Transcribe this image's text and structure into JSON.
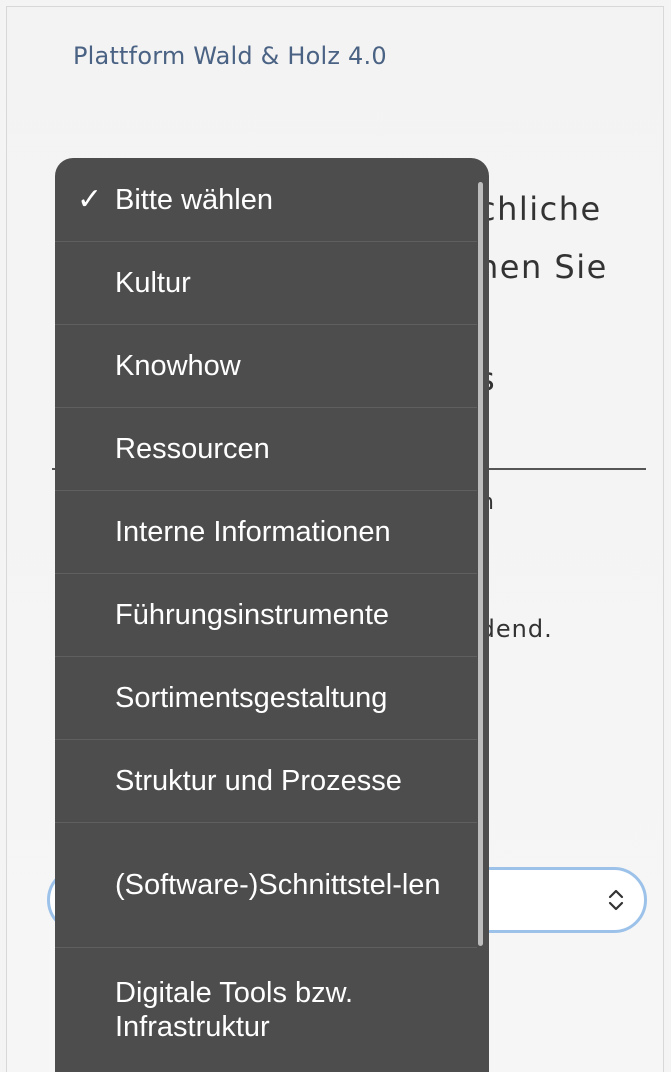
{
  "header": {
    "site_title": "Plattform Wald & Holz 4.0"
  },
  "background": {
    "line1": "chliche",
    "line2": "hen Sie",
    "line3": "s",
    "line4": "n",
    "line5": "idend."
  },
  "select": {
    "icon": "updown-chevron-icon"
  },
  "dropdown": {
    "check_glyph": "✓",
    "selected_index": 0,
    "items": [
      {
        "label": "Bitte wählen"
      },
      {
        "label": "Kultur"
      },
      {
        "label": "Knowhow"
      },
      {
        "label": "Ressourcen"
      },
      {
        "label": "Interne Informationen"
      },
      {
        "label": "Führungsinstrumente"
      },
      {
        "label": "Sortimentsgestaltung"
      },
      {
        "label": "Struktur und Prozesse"
      },
      {
        "label": "(Software-)Schnittstel-len"
      },
      {
        "label": "Digitale Tools bzw. Infrastruktur"
      }
    ]
  },
  "colors": {
    "menu_background": "#4d4d4d",
    "menu_text": "#ffffff",
    "title_color": "#4a6283",
    "select_border": "#9cc2ea"
  }
}
